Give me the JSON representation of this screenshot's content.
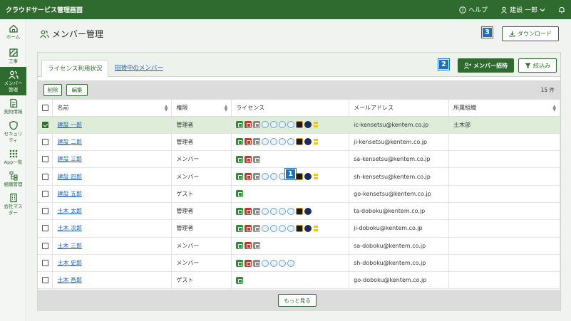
{
  "app_title": "クラウドサービス管理画面",
  "topbar": {
    "help": "ヘルプ",
    "user": "建設 一郎"
  },
  "sidebar": [
    {
      "label": "ホーム",
      "icon": "home-icon"
    },
    {
      "label": "工事",
      "icon": "construction-icon"
    },
    {
      "label": "メンバー管理",
      "icon": "members-icon",
      "active": true
    },
    {
      "label": "契約情報",
      "icon": "contract-icon"
    },
    {
      "label": "セキュリティ",
      "icon": "shield-icon"
    },
    {
      "label": "App一覧",
      "icon": "apps-grid-icon"
    },
    {
      "label": "組織管理",
      "icon": "org-icon"
    },
    {
      "label": "会社マスター",
      "icon": "company-icon"
    }
  ],
  "page_title": "メンバー管理",
  "download_label": "ダウンロード",
  "tabs": {
    "active": "ライセンス利用状況",
    "other": "招待中のメンバー"
  },
  "invite_label": "メンバー招待",
  "filter_label": "絞込み",
  "toolbar": {
    "delete": "削除",
    "edit": "編集",
    "count": "15 件"
  },
  "columns": [
    "名前",
    "権限",
    "ライセンス",
    "メールアドレス",
    "所属組織"
  ],
  "rows": [
    {
      "name": "建設 一郎",
      "role": "管理者",
      "licenses": [
        "g",
        "r",
        "gy",
        "c",
        "c",
        "c",
        "c",
        "kg",
        "n",
        "y"
      ],
      "email": "ic-kensetsu@kentem.co.jp",
      "org": "土木部",
      "checked": true
    },
    {
      "name": "建設 二郎",
      "role": "管理者",
      "licenses": [
        "g",
        "r",
        "gy",
        "c",
        "c",
        "c",
        "c",
        "kg",
        "n",
        "y"
      ],
      "email": "ji-kensetsu@kentem.co.jp",
      "org": "",
      "checked": false
    },
    {
      "name": "建設 三郎",
      "role": "メンバー",
      "licenses": [
        "g",
        "r",
        "gy"
      ],
      "email": "sa-kensetsu@kentem.co.jp",
      "org": "",
      "checked": false
    },
    {
      "name": "建設 四郎",
      "role": "メンバー",
      "licenses": [
        "g",
        "r",
        "gy",
        "c",
        "c",
        "c",
        "c",
        "kg",
        "n",
        "y"
      ],
      "email": "sh-kensetsu@kentem.co.jp",
      "org": "",
      "checked": false
    },
    {
      "name": "建設 五郎",
      "role": "ゲスト",
      "licenses": [
        "g"
      ],
      "email": "go-kensetsu@kentem.co.jp",
      "org": "",
      "checked": false
    },
    {
      "name": "土木 太郎",
      "role": "管理者",
      "licenses": [
        "g",
        "r",
        "gy",
        "c",
        "c",
        "c",
        "c",
        "kg",
        "n"
      ],
      "email": "ta-doboku@kentem.co.jp",
      "org": "",
      "checked": false
    },
    {
      "name": "土木 次郎",
      "role": "管理者",
      "licenses": [
        "g",
        "r",
        "gy",
        "c",
        "c",
        "c",
        "c",
        "kg",
        "n",
        "y"
      ],
      "email": "ji-doboku@kentem.co.jp",
      "org": "",
      "checked": false
    },
    {
      "name": "土木 三郎",
      "role": "メンバー",
      "licenses": [
        "g",
        "r",
        "gy"
      ],
      "email": "sa-doboku@kentem.co.jp",
      "org": "",
      "checked": false
    },
    {
      "name": "土木 史郎",
      "role": "メンバー",
      "licenses": [
        "g",
        "r",
        "gy",
        "c",
        "c",
        "c",
        "c"
      ],
      "email": "sh-doboku@kentem.co.jp",
      "org": "",
      "checked": false
    },
    {
      "name": "土木 吾郎",
      "role": "ゲスト",
      "licenses": [
        "g"
      ],
      "email": "go-doboku@kentem.co.jp",
      "org": "",
      "checked": false
    }
  ],
  "more_label": "もっと見る",
  "callouts": [
    "1",
    "2",
    "3"
  ]
}
